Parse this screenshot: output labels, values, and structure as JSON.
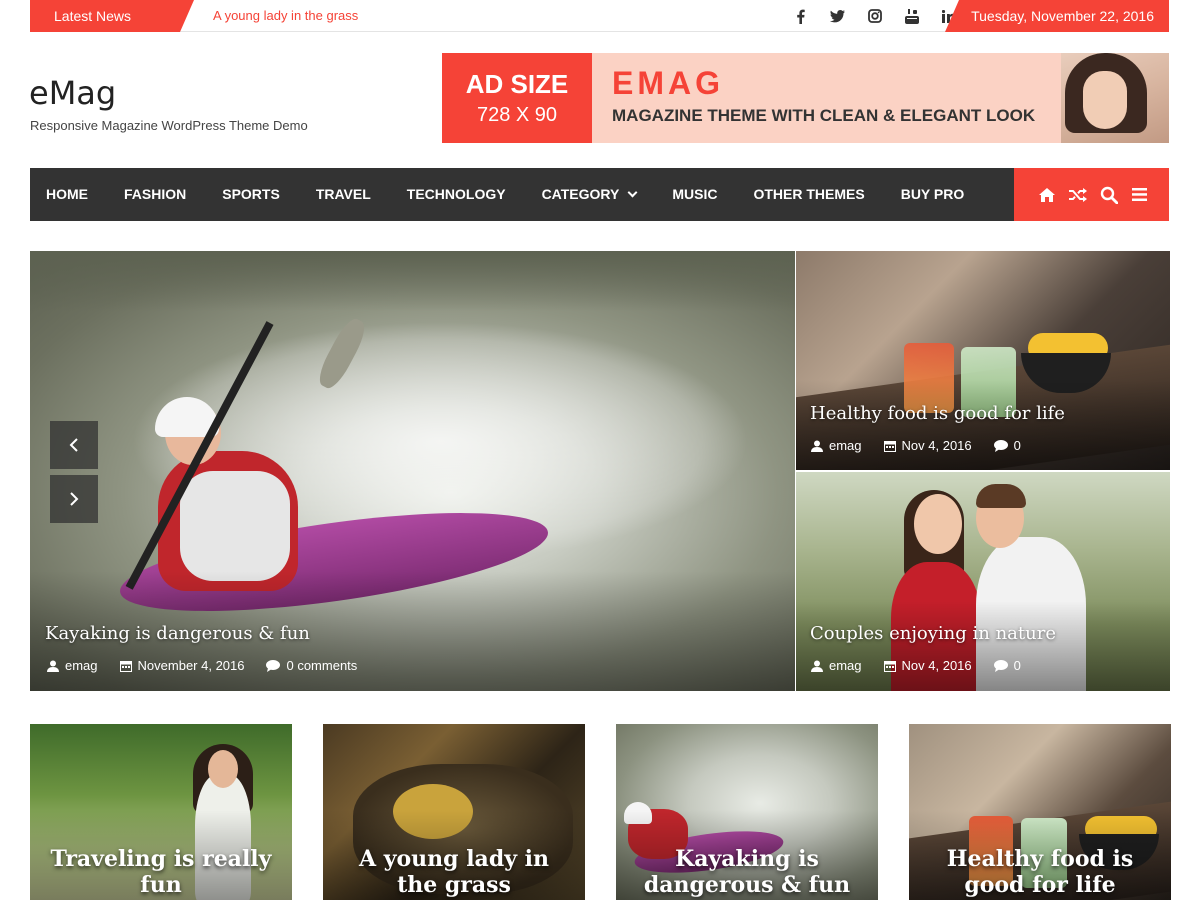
{
  "topbar": {
    "latest_label": "Latest News",
    "latest_headline": "A young lady in the grass",
    "social_icons": [
      "facebook-icon",
      "twitter-icon",
      "instagram-icon",
      "youtube-icon",
      "linkedin-icon"
    ],
    "date": "Tuesday, November 22, 2016"
  },
  "header": {
    "site_title": "eMag",
    "site_description": "Responsive Magazine WordPress Theme Demo"
  },
  "ad": {
    "size_label": "AD SIZE",
    "size_value": "728 X 90",
    "brand": "EMAG",
    "tagline": "MAGAZINE THEME WITH CLEAN & ELEGANT LOOK"
  },
  "nav": {
    "items": [
      {
        "label": "HOME"
      },
      {
        "label": "FASHION"
      },
      {
        "label": "SPORTS"
      },
      {
        "label": "TRAVEL"
      },
      {
        "label": "TECHNOLOGY"
      },
      {
        "label": "CATEGORY"
      },
      {
        "label": "MUSIC"
      },
      {
        "label": "OTHER THEMES"
      },
      {
        "label": "BUY PRO"
      }
    ],
    "tools": [
      "home-icon",
      "shuffle-icon",
      "search-icon",
      "menu-icon"
    ]
  },
  "featured": {
    "main": {
      "title": "Kayaking is dangerous & fun",
      "author": "emag",
      "date": "November 4, 2016",
      "comments": "0 comments"
    },
    "side": [
      {
        "title": "Healthy food is good for life",
        "author": "emag",
        "date": "Nov 4, 2016",
        "comments": "0"
      },
      {
        "title": "Couples enjoying in nature",
        "author": "emag",
        "date": "Nov 4, 2016",
        "comments": "0"
      }
    ]
  },
  "cards": [
    {
      "title": "Traveling is really fun"
    },
    {
      "title": "A young lady in the grass"
    },
    {
      "title": "Kayaking is dangerous & fun"
    },
    {
      "title": "Healthy food is good for life"
    }
  ],
  "colors": {
    "accent": "#f54337",
    "nav_background": "#333333"
  }
}
